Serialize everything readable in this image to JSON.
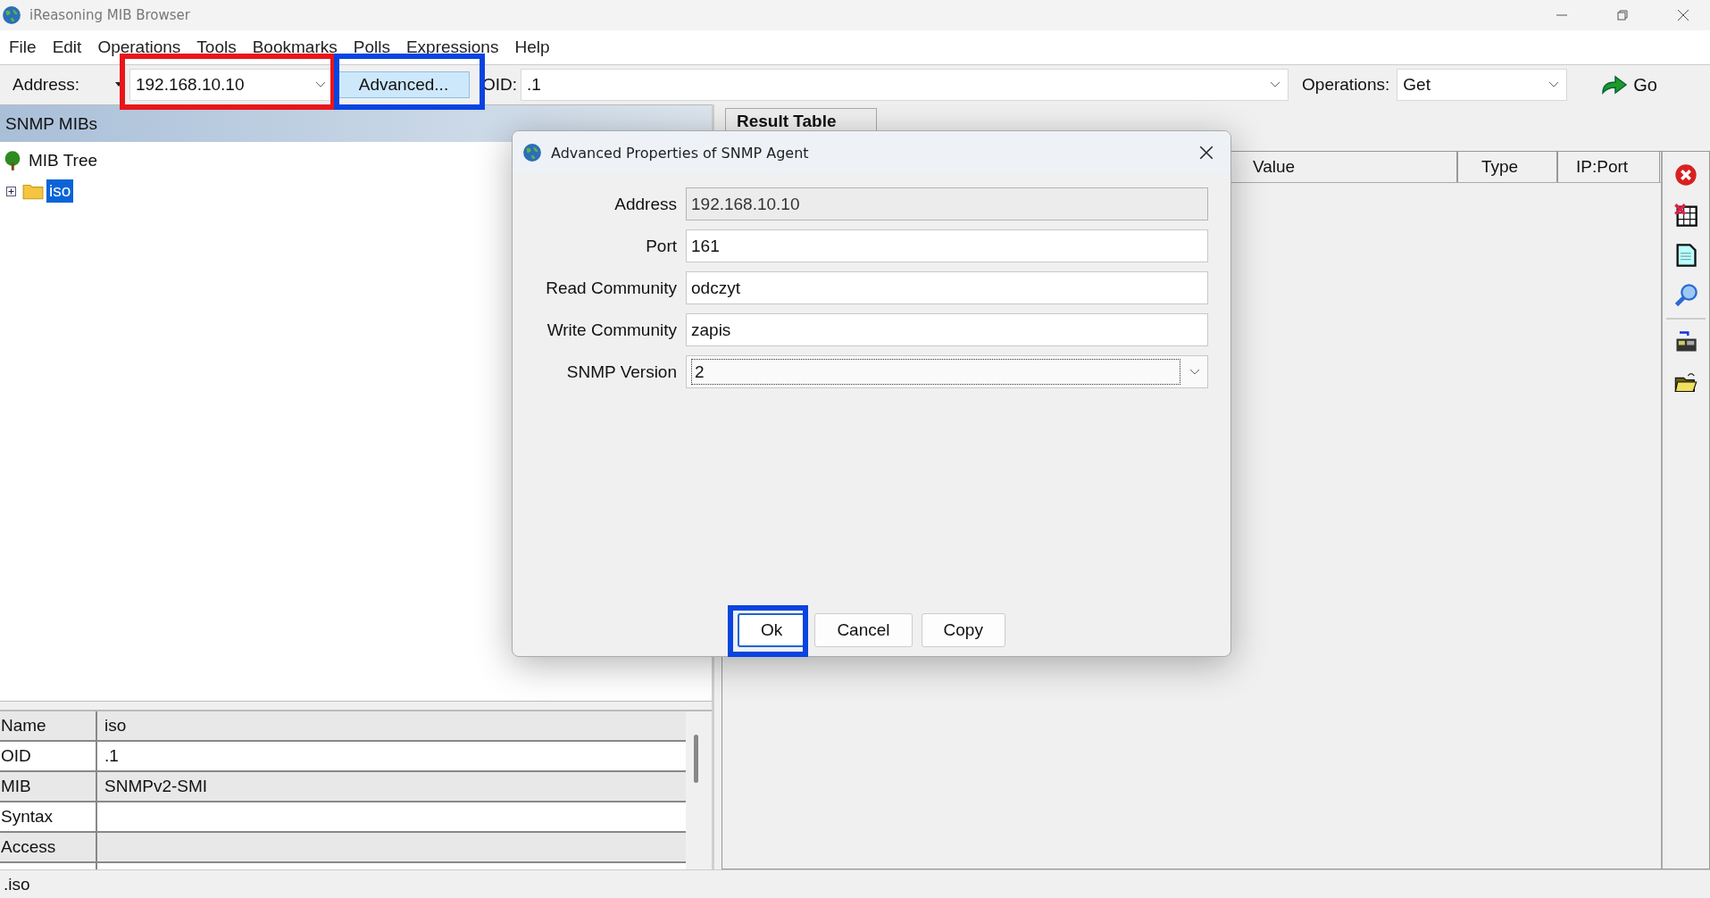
{
  "window": {
    "title": "iReasoning MIB Browser"
  },
  "menu": [
    "File",
    "Edit",
    "Operations",
    "Tools",
    "Bookmarks",
    "Polls",
    "Expressions",
    "Help"
  ],
  "toolbar": {
    "address_label": "Address:",
    "address": "192.168.10.10",
    "advanced_button": "Advanced...",
    "oid_label": "OID:",
    "oid": ".1",
    "operations_label": "Operations:",
    "operation": "Get",
    "go_button": "Go"
  },
  "left_panel": {
    "title": "SNMP MIBs",
    "tree": [
      {
        "label": "MIB Tree",
        "selected": false,
        "children": [
          {
            "label": "iso",
            "selected": true,
            "expanded": false
          }
        ]
      }
    ]
  },
  "properties": [
    {
      "name": "Name",
      "value": "iso"
    },
    {
      "name": "OID",
      "value": ".1"
    },
    {
      "name": "MIB",
      "value": "SNMPv2-SMI"
    },
    {
      "name": "Syntax"
    },
    {
      "name": "Access"
    }
  ],
  "result": {
    "tab": "Result Table",
    "columns": [
      "Value",
      "Type",
      "IP:Port"
    ]
  },
  "status_bar": ".iso",
  "dialog": {
    "title": "Advanced Properties of SNMP Agent",
    "fields": [
      {
        "label": "Address",
        "value": "192.168.10.10",
        "kind": "text",
        "disabled": true
      },
      {
        "label": "Port",
        "value": "161",
        "kind": "text",
        "disabled": false
      },
      {
        "label": "Read Community",
        "value": "odczyt",
        "kind": "text",
        "disabled": false
      },
      {
        "label": "Write Community",
        "value": "zapis",
        "kind": "text",
        "disabled": false
      },
      {
        "label": "SNMP Version",
        "value": "2",
        "kind": "select",
        "disabled": false
      }
    ],
    "buttons": [
      {
        "label": "Ok",
        "focused": true
      },
      {
        "label": "Cancel",
        "focused": false
      },
      {
        "label": "Copy",
        "focused": false
      }
    ]
  },
  "annotations": [
    {
      "color": "#e8161b"
    },
    {
      "color": "#0a44e0"
    },
    {
      "color": "#0a44e0"
    }
  ]
}
